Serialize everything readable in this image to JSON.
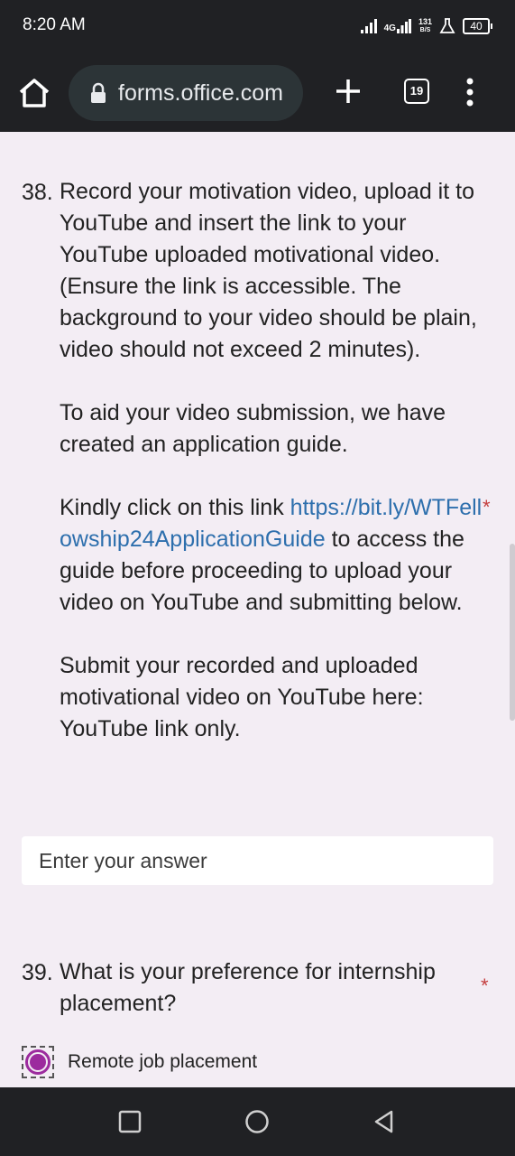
{
  "status_bar": {
    "time": "8:20 AM",
    "network": "4G",
    "speed_value": "131",
    "speed_unit": "B/S",
    "battery": "40",
    "icons": [
      "signal-icon",
      "signal-4g-icon",
      "lab-icon",
      "battery-icon"
    ]
  },
  "browser": {
    "url": "forms.office.com",
    "tab_count": "19",
    "icons": [
      "home-icon",
      "lock-icon",
      "new-tab-icon",
      "tab-switcher-icon",
      "menu-icon"
    ]
  },
  "question_38": {
    "number": "38.",
    "text": "Record your motivation video, upload it to YouTube and insert the link to your YouTube uploaded motivational video. (Ensure the link is accessible. The background to your video should be plain, video should not exceed 2 minutes).",
    "paragraph_2": "To aid your video submission, we have created an application guide.",
    "paragraph_3_prefix": "Kindly click on this link",
    "link": "https://bit.ly/WTFellowship24ApplicationGuide",
    "paragraph_3_suffix": "to access the guide before proceeding to upload your video on YouTube and submitting below.",
    "paragraph_4": "Submit your recorded and uploaded motivational video on YouTube here: YouTube link only.",
    "required_marker": "*",
    "answer_placeholder": "Enter your answer"
  },
  "question_39": {
    "number": "39.",
    "text": "What is your preference for internship placement?",
    "required_marker": "*",
    "options": [
      {
        "label": "Remote job placement",
        "selected": true
      }
    ]
  },
  "colors": {
    "accent": "#9c2b9e",
    "link": "#2d6fad",
    "required": "#c43e3e",
    "background": "#f3edf4"
  },
  "nav_bar": {
    "icons": [
      "recents-icon",
      "home-circle-icon",
      "back-icon"
    ]
  }
}
